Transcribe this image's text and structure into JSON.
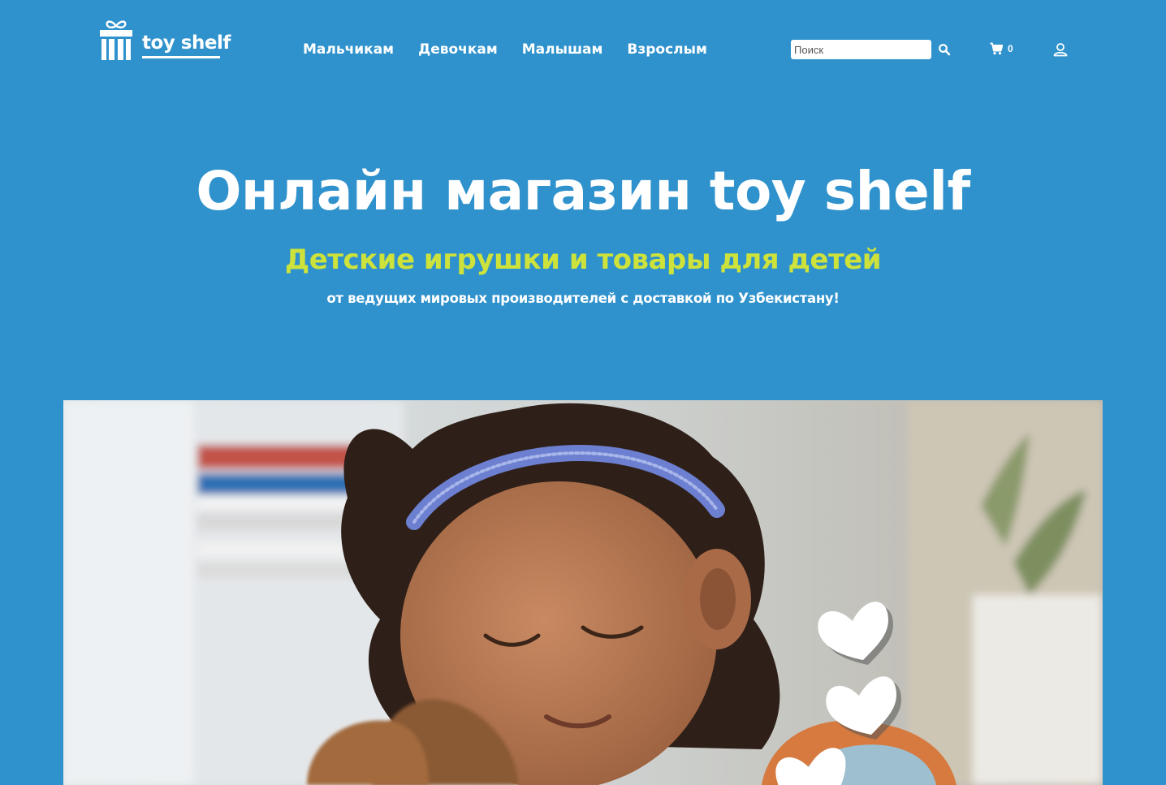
{
  "brand": {
    "name": "toy shelf",
    "logo_icon": "gift-box-icon"
  },
  "nav": {
    "items": [
      {
        "label": "Мальчикам"
      },
      {
        "label": "Девочкам"
      },
      {
        "label": "Малышам"
      },
      {
        "label": "Взрослым"
      }
    ]
  },
  "search": {
    "placeholder": "Поиск",
    "value": "",
    "icon": "search-icon"
  },
  "cart": {
    "icon": "cart-icon",
    "count": "0"
  },
  "account": {
    "icon": "user-icon"
  },
  "hero": {
    "title": "Онлайн магазин toy shelf",
    "subtitle": "Детские игрушки и товары для детей",
    "text": "от ведущих мировых производителей с доставкой по Узбекистану!",
    "image": "photo-girl-hugging-teddy-bear-with-hearts"
  },
  "colors": {
    "background": "#2f92cc",
    "subtitle_accent": "#cde23a",
    "text": "#ffffff"
  }
}
